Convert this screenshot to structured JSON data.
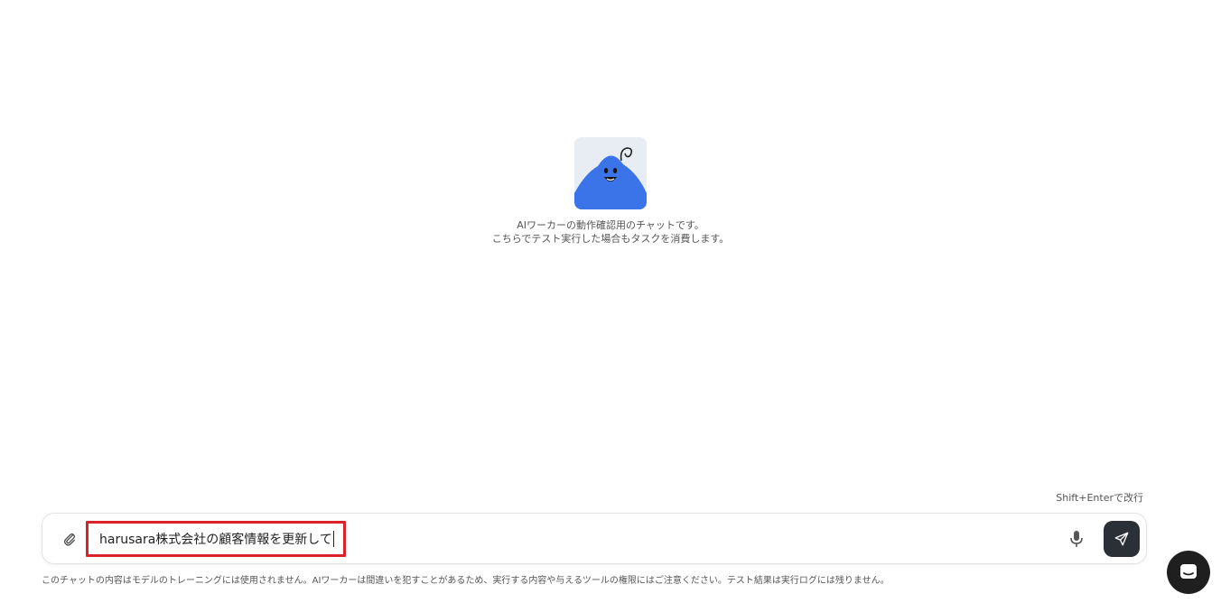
{
  "welcome": {
    "line1": "AIワーカーの動作確認用のチャットです。",
    "line2": "こちらでテスト実行した場合もタスクを消費します。"
  },
  "composer": {
    "hint": "Shift+Enterで改行",
    "input_value": "harusara株式会社の顧客情報を更新して",
    "attach_icon": "paperclip-icon",
    "mic_icon": "microphone-icon",
    "send_icon": "paper-plane-icon"
  },
  "disclaimer": "このチャットの内容はモデルのトレーニングには使用されません。AIワーカーは間違いを犯すことがあるため、実行する内容や与えるツールの権限にはご注意ください。テスト結果は実行ログには残りません。",
  "colors": {
    "mascot_blue": "#3b74e8",
    "highlight_red": "#d9222a",
    "send_bg": "#2b2f36"
  }
}
